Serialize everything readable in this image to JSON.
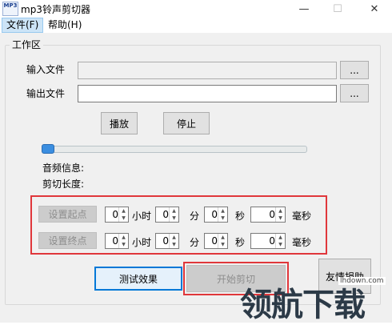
{
  "window": {
    "title": "mp3铃声剪切器",
    "icon_text": "MP3",
    "controls": {
      "minimize": "—",
      "maximize": "☐",
      "close": "✕"
    }
  },
  "menu": {
    "items": [
      {
        "label": "文件(F)"
      },
      {
        "label": "帮助(H)"
      }
    ]
  },
  "workspace": {
    "group_label": "工作区",
    "input_file": {
      "label": "输入文件",
      "value": "",
      "browse_label": "..."
    },
    "output_file": {
      "label": "输出文件",
      "value": "",
      "browse_label": "..."
    },
    "play_button": "播放",
    "stop_button": "停止",
    "slider_position": 0,
    "audio_info_label": "音频信息:",
    "cut_length_label": "剪切长度:",
    "start_point": {
      "button": "设置起点",
      "hours": "0",
      "hours_unit": "小时",
      "minutes": "0",
      "minutes_unit": "分",
      "seconds": "0",
      "seconds_unit": "秒",
      "ms": "0",
      "ms_unit": "毫秒"
    },
    "end_point": {
      "button": "设置终点",
      "hours": "0",
      "hours_unit": "小时",
      "minutes": "0",
      "minutes_unit": "分",
      "seconds": "0",
      "seconds_unit": "秒",
      "ms": "0",
      "ms_unit": "毫秒"
    },
    "test_button": "测试效果",
    "start_cut_button": "开始剪切",
    "donate_button": "友情捐助"
  },
  "watermark": {
    "text": "领航下载",
    "url": "lhdown.com"
  },
  "colors": {
    "highlight_box": "#e0373b",
    "slider_thumb": "#3b8ee0",
    "focus": "#0078d7"
  }
}
